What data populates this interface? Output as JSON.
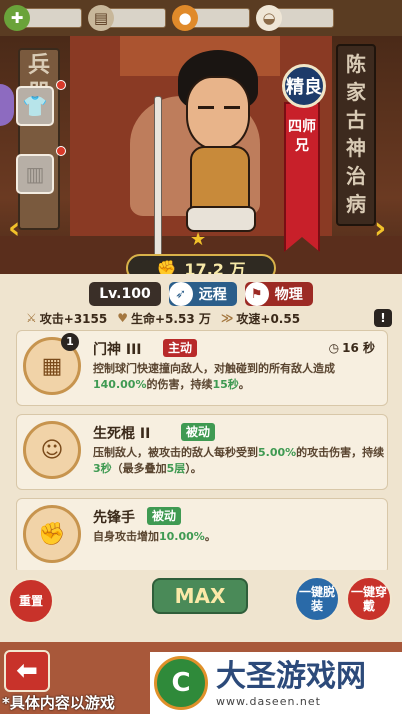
{
  "topbar": {
    "resources": [
      {
        "icon": "plus-cross-icon",
        "glyph": "✚"
      },
      {
        "icon": "scroll-icon",
        "glyph": "▤"
      },
      {
        "icon": "bag-icon",
        "glyph": "●"
      },
      {
        "icon": "bun-icon",
        "glyph": "◒"
      }
    ]
  },
  "stage": {
    "left_rack_text": "兵器",
    "right_sign_text": "陈家古神治病",
    "quality": "精良",
    "hero_name": "四师兄",
    "prev_arrow": "‹",
    "next_arrow": "›",
    "star": "★",
    "power_icon": "✊",
    "power": "17.2 万"
  },
  "info": {
    "level": "Lv.100",
    "range_tag": "远程",
    "damage_tag": "物理",
    "range_icon": "➶",
    "damage_icon": "⚑",
    "stats": {
      "attack": "攻击+3155",
      "hp": "生命+5.53 万",
      "speed": "攻速+0.55"
    },
    "help": "!"
  },
  "skills": [
    {
      "num": "1",
      "name": "门神 III",
      "type": "主动",
      "cd": "16 秒",
      "desc_pre": "控制球门快速撞向敌人，对触碰到的所有敌人造成",
      "desc_hl1": "140.00%",
      "desc_mid": "的伤害，持续",
      "desc_hl2": "15秒",
      "desc_post": "。"
    },
    {
      "name": "生死棍 II",
      "type": "被动",
      "desc_pre": "压制敌人，被攻击的敌人每秒受到",
      "desc_hl1": "5.00%",
      "desc_mid": "的攻击伤害，持续",
      "desc_hl2": "3秒",
      "desc_mid2": "（最多叠加",
      "desc_hl3": "5层",
      "desc_post": "）。"
    },
    {
      "name": "先锋手",
      "type": "被动",
      "desc_pre": "自身攻击增加",
      "desc_hl1": "10.00%",
      "desc_post": "。"
    }
  ],
  "buttons": {
    "reset": "重置",
    "max": "MAX",
    "unequip": "一键脱装",
    "wear": "一键穿戴"
  },
  "footer": {
    "back": "⬅",
    "disclaimer": "*具体内容以游戏",
    "watermark_title": "大圣游戏网",
    "watermark_url": "www.daseen.net",
    "watermark_logo": "C"
  },
  "colors": {
    "panel": "#efe4cf",
    "active": "#b82a2a",
    "passive": "#3f9a52",
    "highlight": "#3f9a52"
  }
}
